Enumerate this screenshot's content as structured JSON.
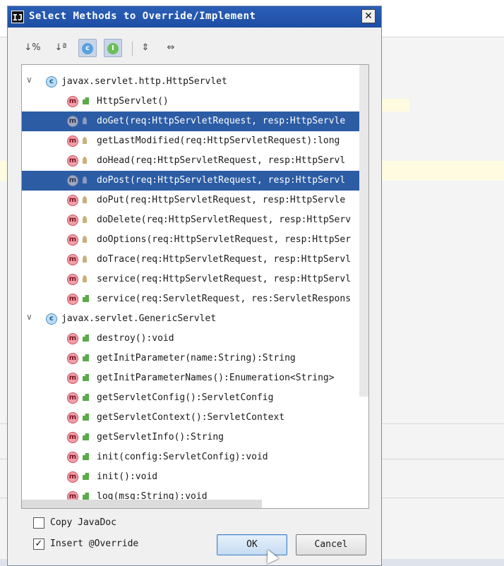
{
  "dialog": {
    "title": "Select Methods to Override/Implement",
    "title_icon": "IJ",
    "close_label": "✕"
  },
  "toolbar": {
    "buttons": [
      {
        "icon": "sort-by-visibility-icon",
        "glyph": "↓%"
      },
      {
        "icon": "sort-alphabetically-icon",
        "glyph": "↓ª"
      },
      {
        "icon": "show-classes-icon",
        "glyph": "c"
      },
      {
        "icon": "show-interfaces-icon",
        "glyph": "I"
      },
      {
        "icon": "expand-all-icon",
        "glyph": "⇕"
      },
      {
        "icon": "collapse-all-icon",
        "glyph": "⇔"
      }
    ]
  },
  "tree": {
    "groups": [
      {
        "label": "javax.servlet.http.HttpServlet",
        "methods": [
          {
            "label": "HttpServlet()",
            "visibility": "public",
            "selected": false
          },
          {
            "label": "doGet(req:HttpServletRequest, resp:HttpServle",
            "visibility": "protected",
            "selected": true
          },
          {
            "label": "getLastModified(req:HttpServletRequest):long",
            "visibility": "protected",
            "selected": false
          },
          {
            "label": "doHead(req:HttpServletRequest, resp:HttpServl",
            "visibility": "protected",
            "selected": false
          },
          {
            "label": "doPost(req:HttpServletRequest, resp:HttpServl",
            "visibility": "protected",
            "selected": true
          },
          {
            "label": "doPut(req:HttpServletRequest, resp:HttpServle",
            "visibility": "protected",
            "selected": false
          },
          {
            "label": "doDelete(req:HttpServletRequest, resp:HttpServ",
            "visibility": "protected",
            "selected": false
          },
          {
            "label": "doOptions(req:HttpServletRequest, resp:HttpSer",
            "visibility": "protected",
            "selected": false
          },
          {
            "label": "doTrace(req:HttpServletRequest, resp:HttpServl",
            "visibility": "protected",
            "selected": false
          },
          {
            "label": "service(req:HttpServletRequest, resp:HttpServl",
            "visibility": "protected",
            "selected": false
          },
          {
            "label": "service(req:ServletRequest, res:ServletRespons",
            "visibility": "public",
            "selected": false
          }
        ]
      },
      {
        "label": "javax.servlet.GenericServlet",
        "methods": [
          {
            "label": "destroy():void",
            "visibility": "public",
            "selected": false
          },
          {
            "label": "getInitParameter(name:String):String",
            "visibility": "public",
            "selected": false
          },
          {
            "label": "getInitParameterNames():Enumeration<String>",
            "visibility": "public",
            "selected": false
          },
          {
            "label": "getServletConfig():ServletConfig",
            "visibility": "public",
            "selected": false
          },
          {
            "label": "getServletContext():ServletContext",
            "visibility": "public",
            "selected": false
          },
          {
            "label": "getServletInfo():String",
            "visibility": "public",
            "selected": false
          },
          {
            "label": "init(config:ServletConfig):void",
            "visibility": "public",
            "selected": false
          },
          {
            "label": "init():void",
            "visibility": "public",
            "selected": false
          },
          {
            "label": "log(msg:String):void",
            "visibility": "public",
            "selected": false
          }
        ]
      }
    ],
    "class_icon_glyph": "c",
    "method_icon_glyph": "m",
    "expanded_glyph": "∨"
  },
  "options": {
    "copy_javadoc": {
      "label": "Copy JavaDoc",
      "checked": false
    },
    "insert_override": {
      "label": "Insert @Override",
      "checked": true
    }
  },
  "buttons": {
    "ok": "OK",
    "cancel": "Cancel"
  },
  "colors": {
    "selection": "#2c5ca4",
    "titlebar": "#1d4ea3",
    "method_icon": "#f0a0a8"
  }
}
